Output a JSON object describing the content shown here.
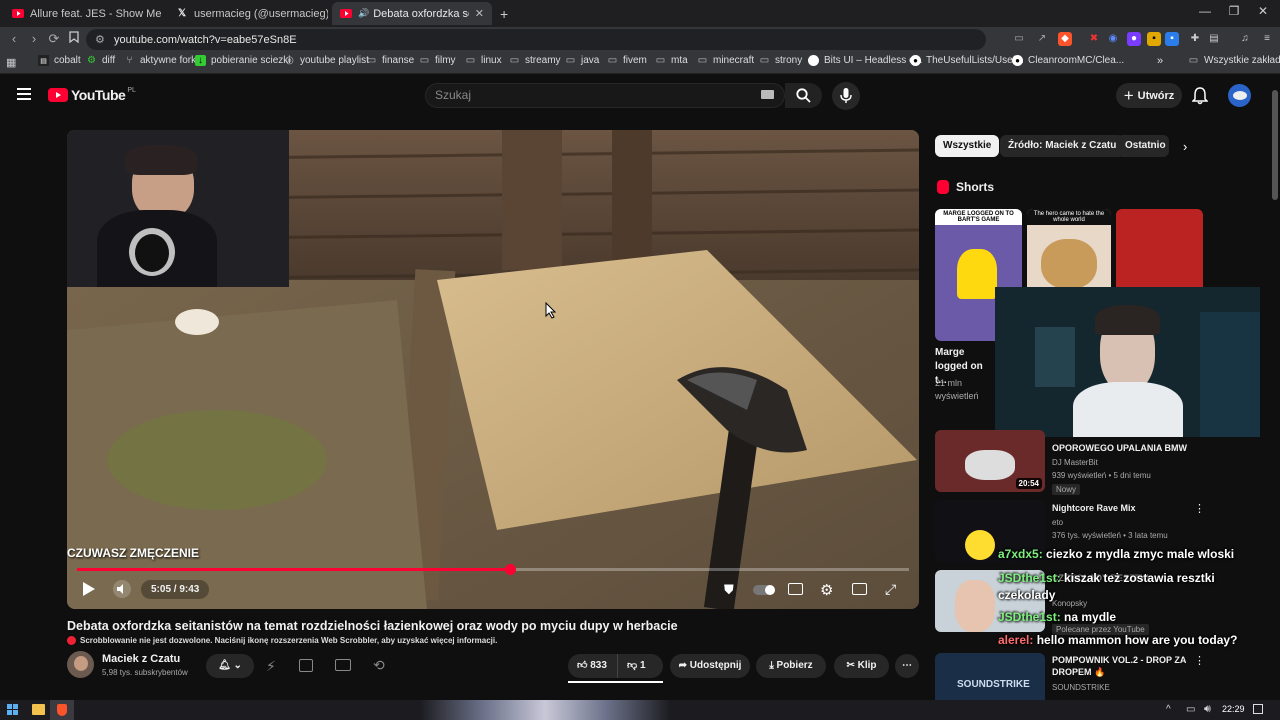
{
  "browser": {
    "tabs": [
      {
        "label": "Allure feat. JES - Show Me the Way (I",
        "icon": "youtube-icon",
        "active": false
      },
      {
        "label": "usermacieg (@usermacieg) / X",
        "icon": "x-icon",
        "active": false
      },
      {
        "label": "Debata oxfordzka seitanistów",
        "icon": "youtube-icon",
        "active": true
      }
    ],
    "url": "youtube.com/watch?v=eabe57eSn8E",
    "bookmarks": [
      "cobalt",
      "diff",
      "aktywne forki",
      "pobieranie sciezki",
      "youtube playlist",
      "finanse",
      "filmy",
      "linux",
      "streamy",
      "java",
      "fivem",
      "mta",
      "minecraft",
      "strony",
      "Bits UI – Headless c...",
      "TheUsefulLists/Usef...",
      "CleanroomMC/Clea..."
    ],
    "bookmarks_other": "Wszystkie zakładki"
  },
  "youtube": {
    "logo": "YouTube",
    "region": "PL",
    "search_placeholder": "Szukaj",
    "create_label": "Utwórz"
  },
  "video": {
    "overlay_text": "CZUWASZ ZMĘCZENIE",
    "time": "5:05 / 9:43",
    "progress": 0.52,
    "title": "Debata oxfordzka seitanistów na temat rozdzielności łazienkowej oraz wody po myciu dupy w herbacie",
    "scrobbler_msg": "Scrobblowanie nie jest dozwolone. Naciśnij ikonę rozszerzenia Web Scrobbler, aby uzyskać więcej informacji.",
    "channel": "Maciek z Czatu",
    "subscribers": "5,98 tys. subskrybentów",
    "likes": "833",
    "dislikes": "1",
    "share": "Udostępnij",
    "download": "Pobierz",
    "clip": "Klip"
  },
  "sidebar": {
    "chips": [
      "Wszystkie",
      "Źródło: Maciek z Czatu",
      "Ostatnio p"
    ],
    "shorts_heading": "Shorts",
    "shorts": [
      {
        "thumb_text": "MARGE LOGGED ON TO BART'S GAME",
        "title": "Marge logged on t...",
        "views": "21 mln wyświetleń"
      },
      {
        "thumb_text": "The hero came to hate the whole world",
        "title": "",
        "views": ""
      },
      {
        "thumb_text": "",
        "title": "",
        "views": ""
      }
    ],
    "videos": [
      {
        "title": "OPOROWEGO UPALANIA BMW",
        "channel": "DJ MasterBit",
        "meta": "939 wyświetleń • 5 dni temu",
        "badge": "Nowy",
        "duration": "20:54"
      },
      {
        "title": "Nightcore Rave Mix",
        "channel": "eto",
        "meta": "376 tys. wyświetleń • 3 lata temu",
        "badge": "",
        "duration": ""
      },
      {
        "title": "CZEKOLADY RESZTKI",
        "channel": "Konopsky",
        "meta": "",
        "badge": "Polecane przez YouTube",
        "duration": ""
      },
      {
        "title": "POMPOWNIK VOL.2 - DROP ZA DROPEM 🔥",
        "channel": "SOUNDSTRIKE",
        "meta": "",
        "badge": "",
        "duration": ""
      }
    ]
  },
  "chat": [
    {
      "user": "a7xdx5:",
      "text": "ciezko z mydla zmyc male wloski"
    },
    {
      "user": "JSDthe1st:",
      "text": "kiszak też zostawia resztki czekolady"
    },
    {
      "user": "JSDthe1st:",
      "text": "na mydle"
    },
    {
      "user": "alerel:",
      "text": "hello mammon how are you today?"
    }
  ],
  "taskbar": {
    "time": "22:29"
  },
  "colors": {
    "accent": "#ff0033",
    "chat_user": "#7ef07e"
  }
}
